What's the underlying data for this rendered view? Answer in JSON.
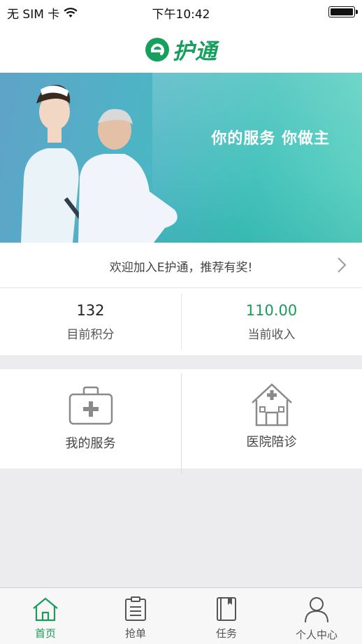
{
  "status_bar": {
    "carrier": "无 SIM 卡",
    "time": "下午10:42"
  },
  "header": {
    "logo_letter": "e",
    "logo_text": "护通"
  },
  "banner": {
    "slogan": "你的服务 你做主"
  },
  "invite": {
    "text": "欢迎加入E护通，推荐有奖!"
  },
  "stats": [
    {
      "value": "132",
      "label": "目前积分"
    },
    {
      "value": "110.00",
      "label": "当前收入"
    }
  ],
  "services": [
    {
      "label": "我的服务",
      "icon": "medical-kit-icon"
    },
    {
      "label": "医院陪诊",
      "icon": "hospital-icon"
    }
  ],
  "tabbar": {
    "items": [
      {
        "label": "首页",
        "icon": "home-icon",
        "active": true
      },
      {
        "label": "抢单",
        "icon": "clipboard-icon",
        "active": false
      },
      {
        "label": "任务",
        "icon": "book-icon",
        "active": false
      },
      {
        "label": "个人中心",
        "icon": "person-icon",
        "active": false
      }
    ]
  },
  "colors": {
    "brand": "#1a9b5a",
    "banner_from": "#5fa3c8",
    "banner_to": "#3cc0b8"
  }
}
